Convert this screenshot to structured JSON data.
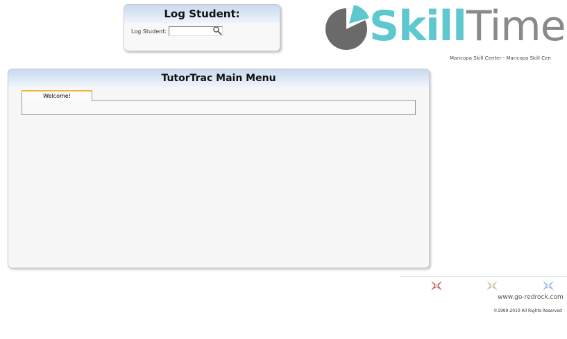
{
  "log_student": {
    "title": "Log Student:",
    "label": "Log Student:",
    "value": ""
  },
  "logo": {
    "word_part1": "Skill",
    "word_part2": "Time",
    "subcaption": "Maricopa Skill Center - Maricopa Skill Cen",
    "colors": {
      "teal": "#5ec8cf",
      "gray": "#8a8a8a"
    }
  },
  "main_menu": {
    "title": "TutorTrac Main Menu",
    "tabs": [
      {
        "label": "Welcome!"
      }
    ]
  },
  "footer": {
    "url": "www.go-redrock.com",
    "copyright": "©1999-2010 All Rights Reserved"
  }
}
